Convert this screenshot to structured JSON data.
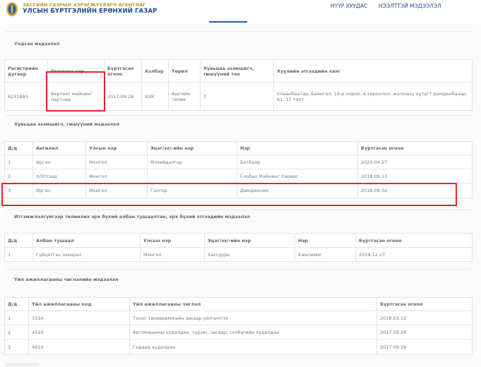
{
  "header": {
    "agency_line": "ЗАСГИЙН ГАЗРЫН ХЭРЭГЖҮҮЛЭГЧ АГЕНТЛАГ",
    "agency_name": "УЛСЫН БҮРТГЭЛИЙН ЕРӨНХИЙ ГАЗАР",
    "nav": {
      "home": "НҮҮР ХУУДАС",
      "register": "НЭЭЛТТЭЙ МЭДЭЭЛЭЛ"
    }
  },
  "basic": {
    "title": "Үндсэн мэдээлэл",
    "headers": [
      "Регистрийн дугаар",
      "Оноосон нэр",
      "Бүртгэсэн огноо",
      "Хэлбэр",
      "Төрөл",
      "Хувьцаа эзэмшигч, гишүүний тоо",
      "Хуулийн этгээдийн хаяг"
    ],
    "row": [
      "6231683",
      "Вертекс майнинг партнер",
      "2017.09.28",
      "ХХК",
      "Ашгийн төлөө",
      "3",
      "Улаанбаатар, Баянгол, 19-р хороо, 4 хороолол, жалханц хутагт дамдинбазар, 61, 37 тоот"
    ]
  },
  "shareholders": {
    "title": "Хувьцаа эзэмшигч, гишүүний мэдээлэл",
    "headers": [
      "Д/д",
      "Ангилал",
      "Улсын нэр",
      "Эцэг/эх/-ийн нэр",
      "Нэр",
      "Бүртгэсэн огноо"
    ],
    "rows": [
      [
        "1",
        "Иргэн",
        "Монгол",
        "Өлзийдэлгэр",
        "Батбаяр",
        "2020.04.27"
      ],
      [
        "2",
        "Х/Этгээд",
        "Монгол",
        "",
        "Глобал Майнинг Сервис",
        "2018.09.13"
      ],
      [
        "3",
        "Иргэн",
        "Монгол",
        "Гонгор",
        "Дамдинням",
        "2018.08.02"
      ]
    ]
  },
  "officials": {
    "title": "Итгэмжлэлгүйгээр төлөөлөх эрх бүхий албан тушаалтан, эрх бүхий этгээдийн мэдээлэл",
    "headers": [
      "Д/д",
      "Албан тушаал",
      "Улсын нэр",
      "Эцэг/эх/-ийн нэр",
      "Нэр",
      "Бүртгэсэн огноо"
    ],
    "rows": [
      [
        "1",
        "Гүйцэтгэх захирал",
        "Монгол",
        "Хассуурь",
        "Хашчимэг",
        "2019.12.27"
      ]
    ]
  },
  "activities": {
    "title": "Үйл ажиллагааны чиглэлийн мэдээлэл",
    "headers": [
      "Д/д",
      "Үйл ажиллагааны код",
      "Үйл ажиллагааны чиглэл",
      "Бүртгэсэн огноо"
    ],
    "rows": [
      [
        "1",
        "3314",
        "Тоног төхөөрөмжийн засвар үйлчилгээ",
        "2018.03.12"
      ],
      [
        "2",
        "4510",
        "Автомашины худалдаа, түрээс, засвар, сэлбэгийн худалдаа",
        "2017.09.28"
      ],
      [
        "3",
        "4610",
        "Гадаад худалдаа",
        "2017.09.28"
      ]
    ]
  },
  "colors": {
    "highlight": "#e2242b",
    "brand_blue": "#1f4b8f",
    "brand_gold": "#b8932a"
  }
}
